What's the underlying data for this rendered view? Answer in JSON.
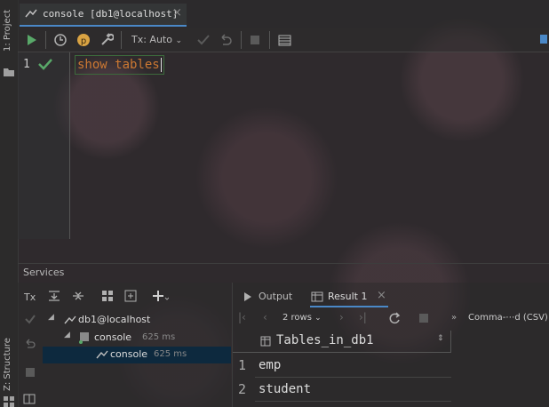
{
  "sidebar": {
    "project_label": "1: Project",
    "structure_label": "Z: Structure"
  },
  "tab": {
    "label": "console [db1@localhost]",
    "close": "×"
  },
  "toolbar": {
    "tx_label": "Tx: Auto"
  },
  "editor": {
    "line_number": "1",
    "code": "show tables"
  },
  "services": {
    "title": "Services",
    "tx_button": "Tx",
    "tree": [
      {
        "label": "db1@localhost",
        "time": ""
      },
      {
        "label": "console",
        "time": "625 ms"
      },
      {
        "label": "console",
        "time": "625 ms"
      }
    ]
  },
  "results": {
    "tabs": [
      {
        "label": "Output"
      },
      {
        "label": "Result 1",
        "close": "×"
      }
    ],
    "rows_selector": "2 rows",
    "export_label": "Comma-⋯d (CSV)",
    "column_header": "Tables_in_db1",
    "rows": [
      {
        "num": "1",
        "value": "emp"
      },
      {
        "num": "2",
        "value": "student"
      }
    ]
  },
  "colors": {
    "accent": "#4a88c7",
    "run_green": "#59a869",
    "keyword_orange": "#cc7832",
    "selection": "#0d293e"
  },
  "icons": [
    "run-icon",
    "history-icon",
    "profile-icon",
    "settings-icon",
    "commit-icon",
    "rollback-icon",
    "stop-icon",
    "table-view-icon",
    "checkmark-icon",
    "tree-expand-icon",
    "tree-collapse-icon",
    "group-icon",
    "add-icon"
  ]
}
